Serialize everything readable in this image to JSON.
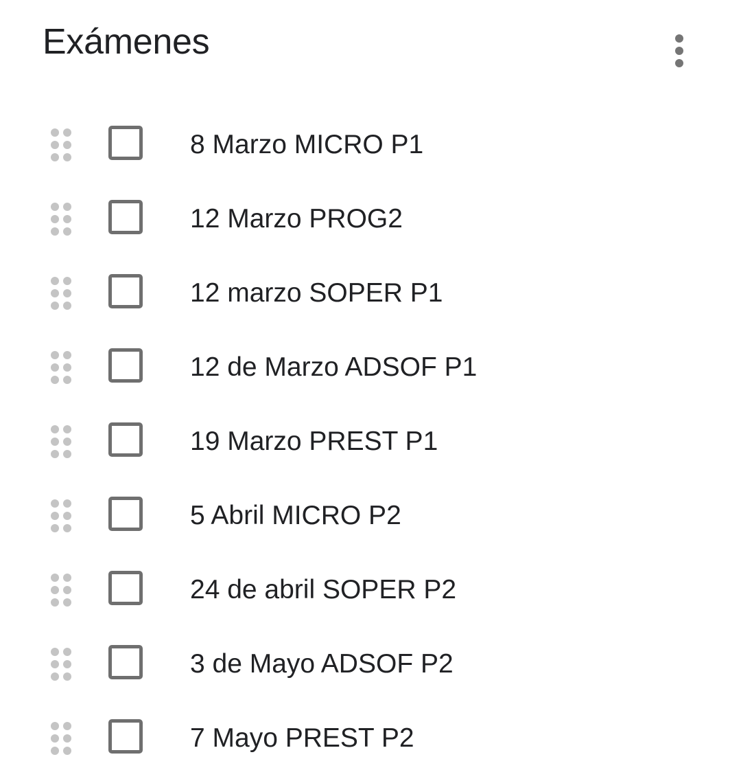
{
  "header": {
    "title": "Exámenes",
    "menu_icon": "more-vert-icon"
  },
  "colors": {
    "text": "#202124",
    "checkbox_border": "#6f6f6f",
    "drag_handle": "#c4c4c4",
    "menu_icon": "#757575"
  },
  "tasks": [
    {
      "label": "8 Marzo MICRO P1",
      "checked": false
    },
    {
      "label": "12 Marzo PROG2",
      "checked": false
    },
    {
      "label": "12 marzo SOPER P1",
      "checked": false
    },
    {
      "label": "12 de Marzo ADSOF P1",
      "checked": false
    },
    {
      "label": "19 Marzo PREST P1",
      "checked": false
    },
    {
      "label": "5 Abril MICRO P2",
      "checked": false
    },
    {
      "label": "24 de abril SOPER P2",
      "checked": false
    },
    {
      "label": "3 de Mayo ADSOF P2",
      "checked": false
    },
    {
      "label": "7 Mayo PREST P2",
      "checked": false
    }
  ]
}
